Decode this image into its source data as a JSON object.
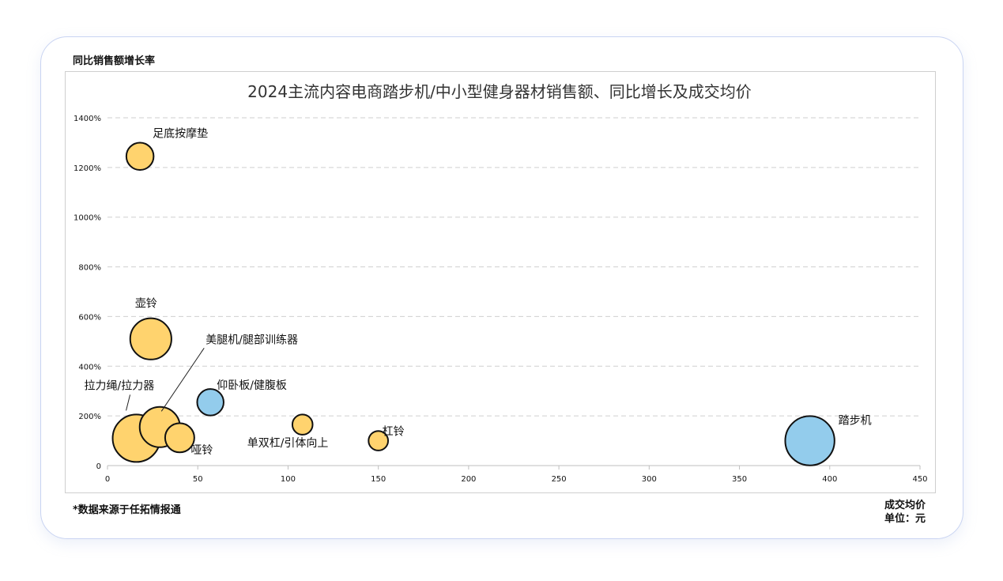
{
  "chart_data": {
    "type": "scatter",
    "title": "2024主流内容电商踏步机/中小型健身器材销售额、同比增长及成交均价",
    "ylabel": "同比销售额增长率",
    "xlabel": "成交均价",
    "x_unit": "单位：元",
    "source": "*数据来源于任拓情报通",
    "xlim": [
      0,
      450
    ],
    "ylim": [
      0,
      1400
    ],
    "x_ticks": [
      "0",
      "50",
      "100",
      "150",
      "200",
      "250",
      "300",
      "350",
      "400",
      "450"
    ],
    "y_ticks": [
      "0",
      "200%",
      "400%",
      "600%",
      "800%",
      "1000%",
      "1200%",
      "1400%"
    ],
    "grid": "horizontal-dashed",
    "points": [
      {
        "label": "足底按摩垫",
        "x": 18,
        "y": 1245,
        "size": 0.22,
        "color": "#FFD36E"
      },
      {
        "label": "壶铃",
        "x": 24,
        "y": 510,
        "size": 0.7,
        "color": "#FFD36E"
      },
      {
        "label": "拉力绳/拉力器",
        "x": 16,
        "y": 110,
        "size": 1.0,
        "color": "#FFD36E"
      },
      {
        "label": "美腿机/腿部训练器",
        "x": 29,
        "y": 155,
        "size": 0.66,
        "color": "#FFD36E"
      },
      {
        "label": "哑铃",
        "x": 40,
        "y": 112,
        "size": 0.27,
        "color": "#FFD36E"
      },
      {
        "label": "仰卧板/健腹板",
        "x": 57,
        "y": 255,
        "size": 0.2,
        "color": "#93CCEC"
      },
      {
        "label": "单双杠/引体向上",
        "x": 108,
        "y": 165,
        "size": 0.08,
        "color": "#FFD36E"
      },
      {
        "label": "杠铃",
        "x": 150,
        "y": 100,
        "size": 0.07,
        "color": "#FFD36E"
      },
      {
        "label": "踏步机",
        "x": 389,
        "y": 100,
        "size": 1.1,
        "color": "#93CCEC"
      }
    ]
  }
}
